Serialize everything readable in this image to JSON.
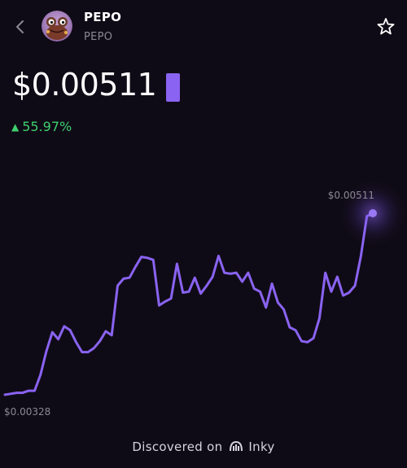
{
  "header": {
    "back_icon": "chevron-left-icon",
    "token_name": "PEPO",
    "token_symbol": "PEPO",
    "favorite_icon": "star-outline-icon"
  },
  "price": {
    "value": "$0.00511",
    "change": "55.97%",
    "change_direction": "up",
    "change_color": "#3ecf6e",
    "accent_color": "#8a63f2"
  },
  "chart_data": {
    "type": "line",
    "high_label": "$0.00511",
    "low_label": "$0.00328",
    "ylim": [
      0.00328,
      0.00511
    ],
    "values": [
      0.00328,
      0.00329,
      0.0033,
      0.0033,
      0.00332,
      0.00332,
      0.00348,
      0.00372,
      0.00391,
      0.00384,
      0.00397,
      0.00393,
      0.00381,
      0.00371,
      0.00371,
      0.00375,
      0.00382,
      0.00392,
      0.00388,
      0.00438,
      0.00445,
      0.00446,
      0.00457,
      0.00467,
      0.00466,
      0.00464,
      0.00418,
      0.00422,
      0.00425,
      0.0046,
      0.00431,
      0.00432,
      0.00446,
      0.0043,
      0.00438,
      0.00447,
      0.00468,
      0.00451,
      0.0045,
      0.00451,
      0.00442,
      0.00451,
      0.00435,
      0.00432,
      0.00416,
      0.0044,
      0.00421,
      0.00414,
      0.00396,
      0.00393,
      0.00382,
      0.00381,
      0.00385,
      0.00405,
      0.00451,
      0.00432,
      0.00447,
      0.00428,
      0.00431,
      0.00438,
      0.00468,
      0.00508,
      0.00511
    ]
  },
  "footer": {
    "text": "Discovered on",
    "brand": "Inky",
    "brand_icon": "inky-logo-icon"
  }
}
